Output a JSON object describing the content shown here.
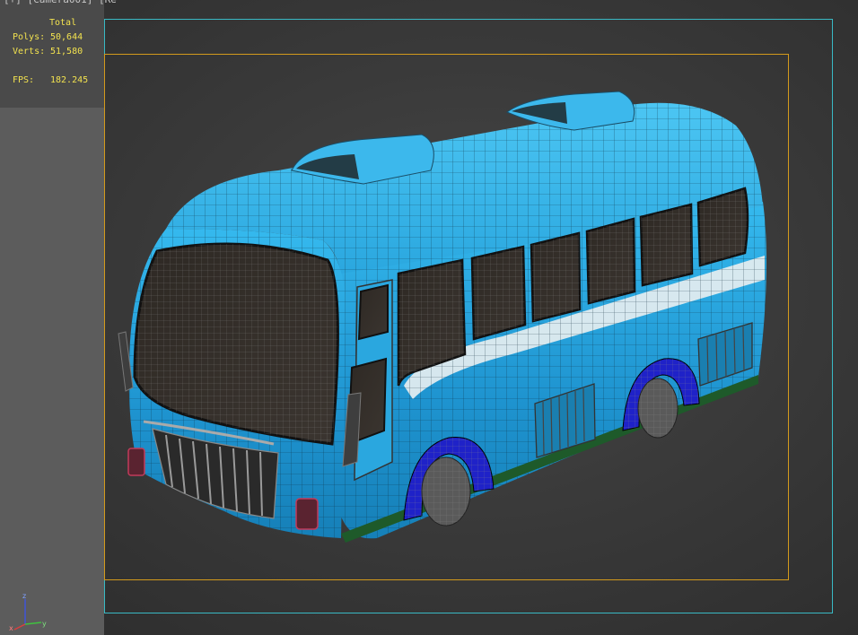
{
  "viewport": {
    "label": "[+] [Camera001] [Re"
  },
  "stats": {
    "header": "Total",
    "polys_label": "Polys:",
    "polys_value": "50,644",
    "verts_label": "Verts:",
    "verts_value": "51,580",
    "fps_label": "FPS:",
    "fps_value": "182.245"
  },
  "gizmo": {
    "z": "z",
    "y": "y",
    "x": "x"
  },
  "colors": {
    "stats_text": "#f2e24f",
    "safe_frame": "#39b9c4",
    "render_frame": "#d39a1c",
    "bus_body": "#2aa7df",
    "wheel_arch": "#1f22c8"
  }
}
